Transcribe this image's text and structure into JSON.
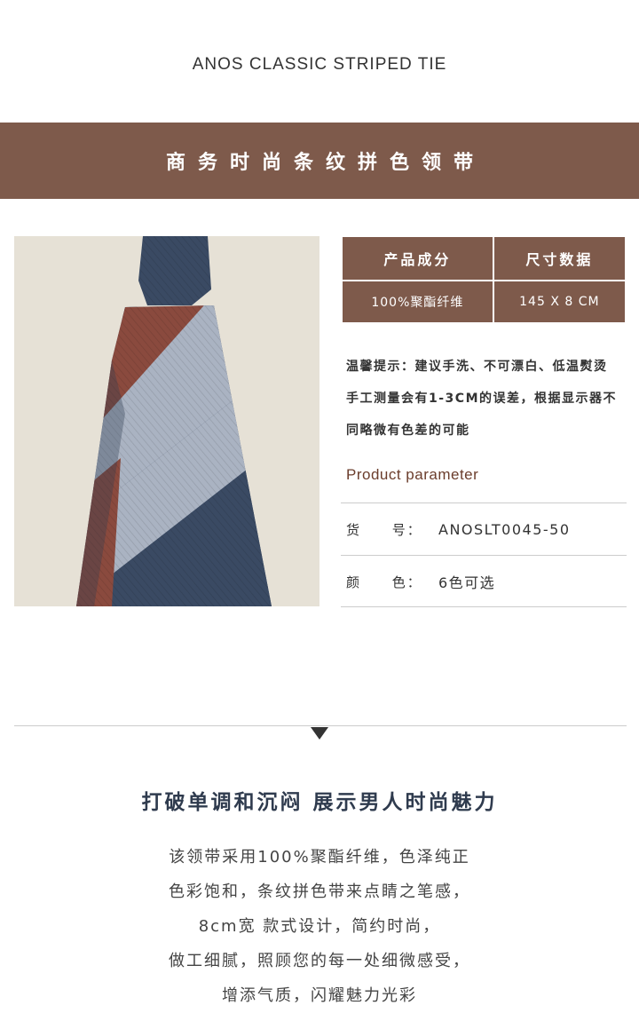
{
  "header": {
    "title_en": "ANOS CLASSIC STRIPED TIE"
  },
  "banner": {
    "title_cn": "商务时尚条纹拼色领带"
  },
  "spec": {
    "headers": [
      "产品成分",
      "尺寸数据"
    ],
    "values": [
      "100%聚酯纤维",
      "145 X 8  CM"
    ]
  },
  "tips": [
    "温馨提示：建议手洗、不可漂白、低温熨烫",
    "手工测量会有1-3CM的误差，根据显示器不",
    "同略微有色差的可能"
  ],
  "params": {
    "title": "Product parameter",
    "rows": [
      {
        "key": "货 号：",
        "value": "ANOSLT0045-50"
      },
      {
        "key": "颜 色：",
        "value": "6色可选"
      }
    ]
  },
  "slogan": "打破单调和沉闷 展示男人时尚魅力",
  "description": [
    "该领带采用100%聚酯纤维，色泽纯正",
    "色彩饱和，条纹拼色带来点睛之笔感，",
    "8cm宽 款式设计，简约时尚，",
    "做工细腻，照顾您的每一处细微感受，",
    "增添气质，闪耀魅力光彩"
  ],
  "colors": {
    "brand_brown": "#7e5a4b",
    "param_title": "#6b3d2c",
    "slogan_navy": "#2f3b4e",
    "tie_navy": "#3a4a63",
    "tie_silver": "#aab3c2",
    "tie_rust": "#8a4a3e",
    "photo_bg": "#e6e1d6"
  }
}
